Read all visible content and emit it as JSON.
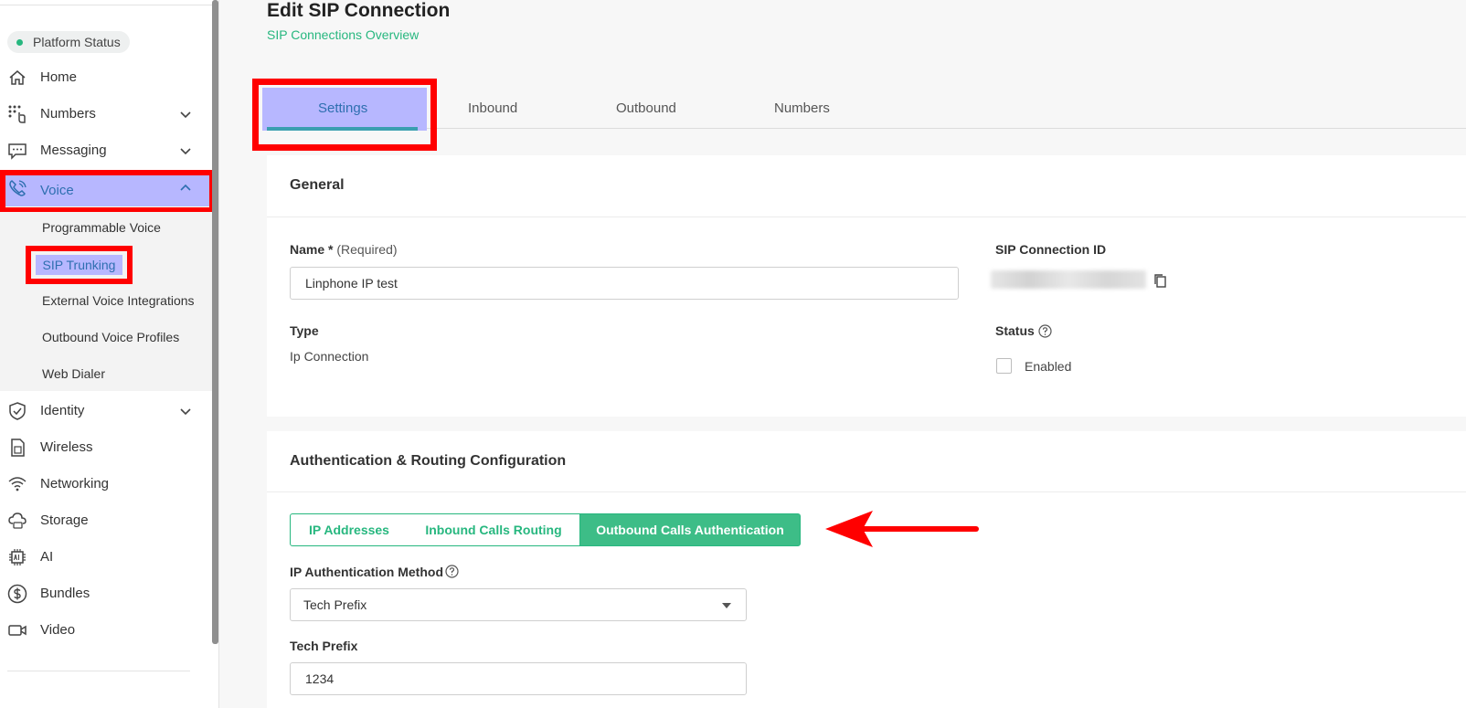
{
  "sidebar": {
    "platform_status": "Platform Status",
    "items": [
      {
        "label": "Home",
        "icon": "home-icon"
      },
      {
        "label": "Numbers",
        "icon": "dialpad-icon"
      },
      {
        "label": "Messaging",
        "icon": "chat-icon"
      },
      {
        "label": "Voice",
        "icon": "phone-icon"
      },
      {
        "label": "Identity",
        "icon": "shield-check-icon"
      },
      {
        "label": "Wireless",
        "icon": "sim-card-icon"
      },
      {
        "label": "Networking",
        "icon": "wifi-icon"
      },
      {
        "label": "Storage",
        "icon": "cloud-storage-icon"
      },
      {
        "label": "AI",
        "icon": "chip-icon"
      },
      {
        "label": "Bundles",
        "icon": "dollar-icon"
      },
      {
        "label": "Video",
        "icon": "video-icon"
      }
    ],
    "voice_subitems": [
      "Programmable Voice",
      "SIP Trunking",
      "External Voice Integrations",
      "Outbound Voice Profiles",
      "Web Dialer"
    ]
  },
  "header": {
    "title": "Edit SIP Connection",
    "breadcrumb": "SIP Connections Overview"
  },
  "tabs": [
    "Settings",
    "Inbound",
    "Outbound",
    "Numbers"
  ],
  "general": {
    "title": "General",
    "name_label": "Name",
    "name_required_mark": "*",
    "name_required_text": "(Required)",
    "name_value": "Linphone IP test",
    "id_label": "SIP Connection ID",
    "type_label": "Type",
    "type_value": "Ip Connection",
    "status_label": "Status",
    "enabled_label": "Enabled"
  },
  "auth": {
    "title": "Authentication & Routing Configuration",
    "segments": [
      "IP Addresses",
      "Inbound Calls Routing",
      "Outbound Calls Authentication"
    ],
    "method_label": "IP Authentication Method",
    "method_value": "Tech Prefix",
    "tech_prefix_label": "Tech Prefix",
    "tech_prefix_value": "1234"
  },
  "colors": {
    "accent_green": "#27b77f",
    "highlight": "#b7b7ff",
    "annotation_red": "#ff0000"
  }
}
